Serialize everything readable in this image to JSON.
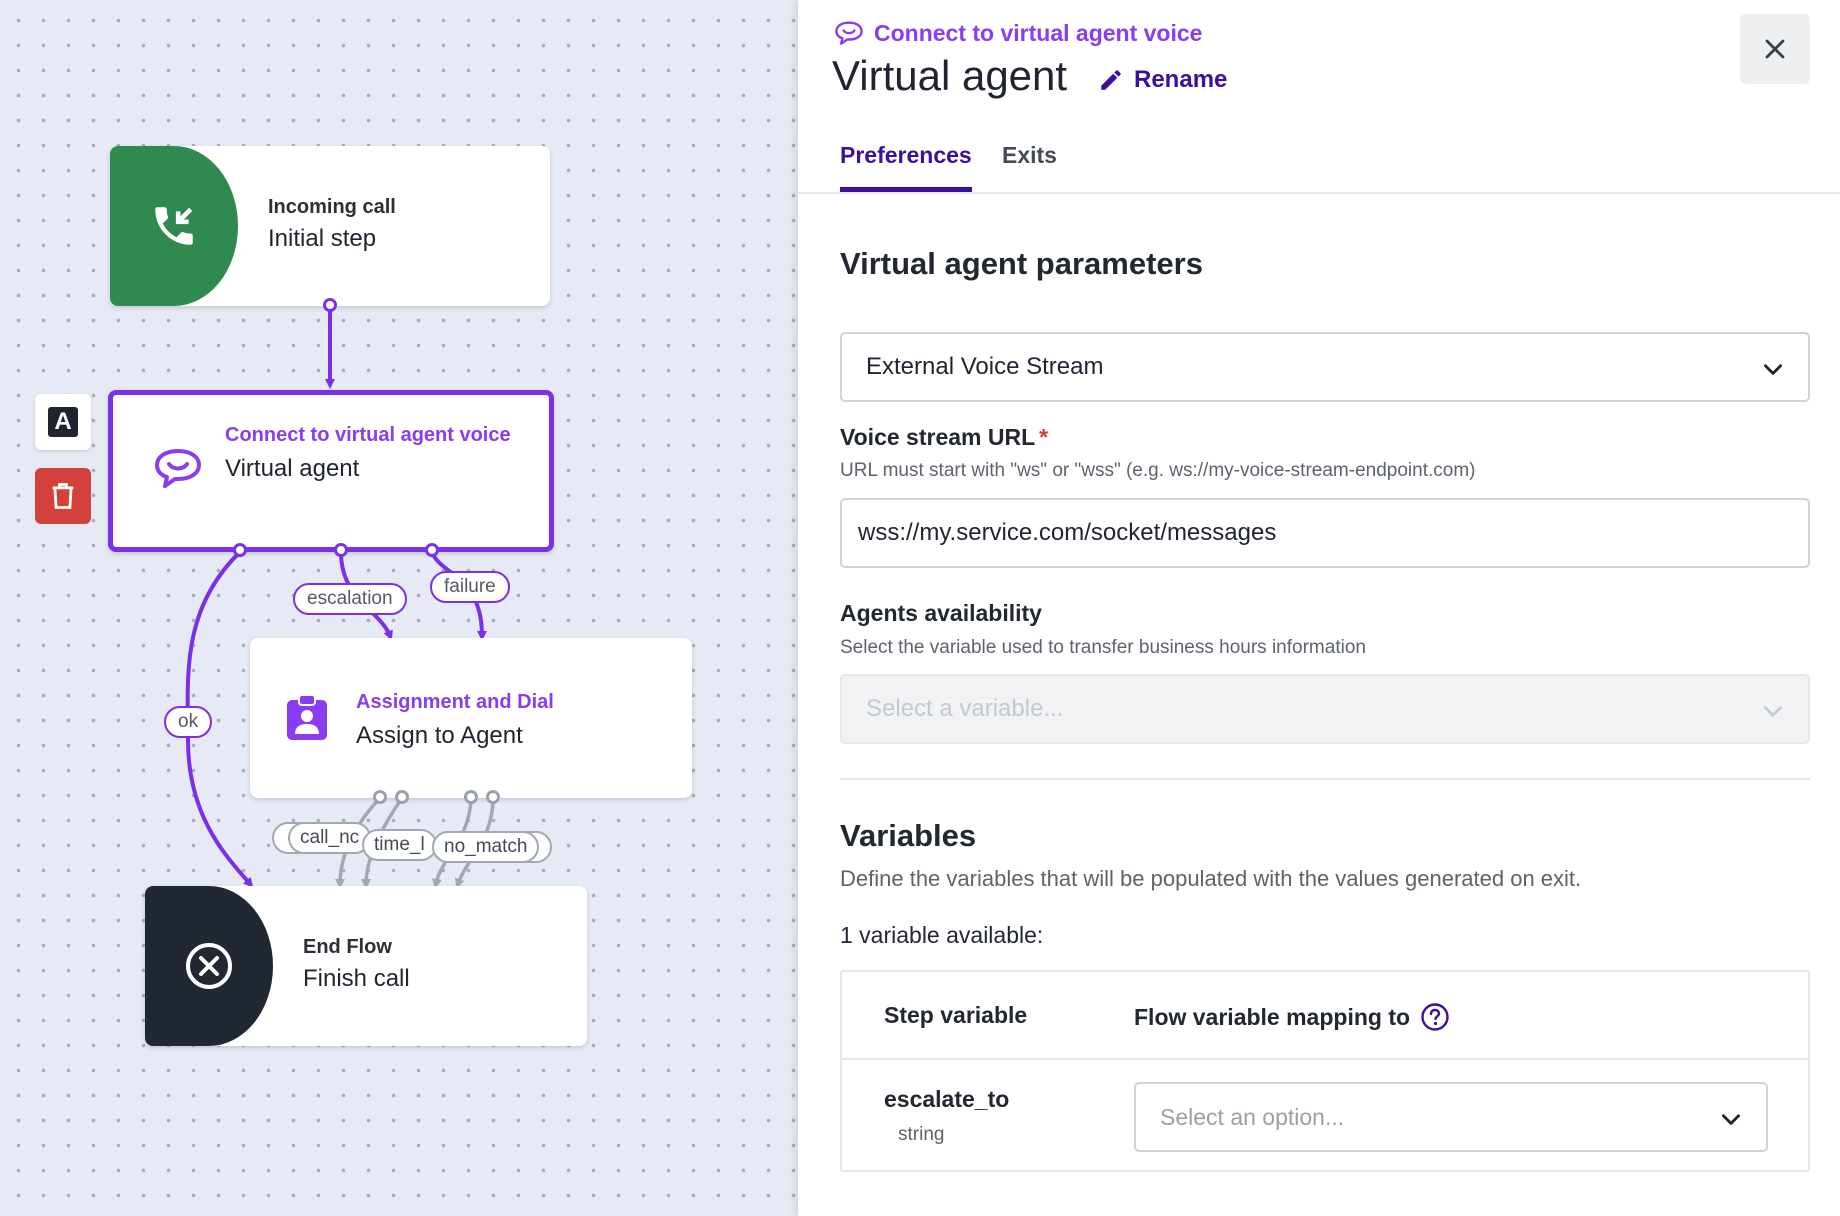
{
  "canvas": {
    "nodes": {
      "incoming": {
        "type": "Incoming call",
        "name": "Initial step"
      },
      "virtual_agent": {
        "type": "Connect to virtual agent voice",
        "name": "Virtual agent"
      },
      "assign": {
        "type": "Assignment and Dial",
        "name": "Assign to Agent"
      },
      "end": {
        "type": "End Flow",
        "name": "Finish call"
      }
    },
    "edge_labels": {
      "escalation": "escalation",
      "failure": "failure",
      "ok": "ok",
      "call_no": "call_nc",
      "time": "time_l",
      "no_match": "no_match"
    },
    "side_buttons": {
      "label_button": "A"
    },
    "colors": {
      "accent": "#7c2fe8",
      "incoming": "#2e8a4e",
      "end": "#222831",
      "delete": "#d2413a"
    }
  },
  "panel": {
    "kicker": "Connect to virtual agent voice",
    "title": "Virtual agent",
    "rename_label": "Rename",
    "tabs": [
      {
        "label": "Preferences",
        "active": true
      },
      {
        "label": "Exits",
        "active": false
      }
    ],
    "params": {
      "section_title": "Virtual agent parameters",
      "stream_type": "External Voice Stream",
      "url_label": "Voice stream URL",
      "url_required": "*",
      "url_help": "URL must start with \"ws\" or \"wss\" (e.g. ws://my-voice-stream-endpoint.com)",
      "url_value": "wss://my.service.com/socket/messages",
      "availability_label": "Agents availability",
      "availability_help": "Select the variable used to transfer business hours information",
      "availability_placeholder": "Select a variable..."
    },
    "variables": {
      "section_title": "Variables",
      "description": "Define the variables that will be populated with the values generated on exit.",
      "count_text": "1 variable available:",
      "col_step": "Step variable",
      "col_flow": "Flow variable mapping to",
      "rows": [
        {
          "name": "escalate_to",
          "type": "string",
          "placeholder": "Select an option..."
        }
      ]
    }
  }
}
